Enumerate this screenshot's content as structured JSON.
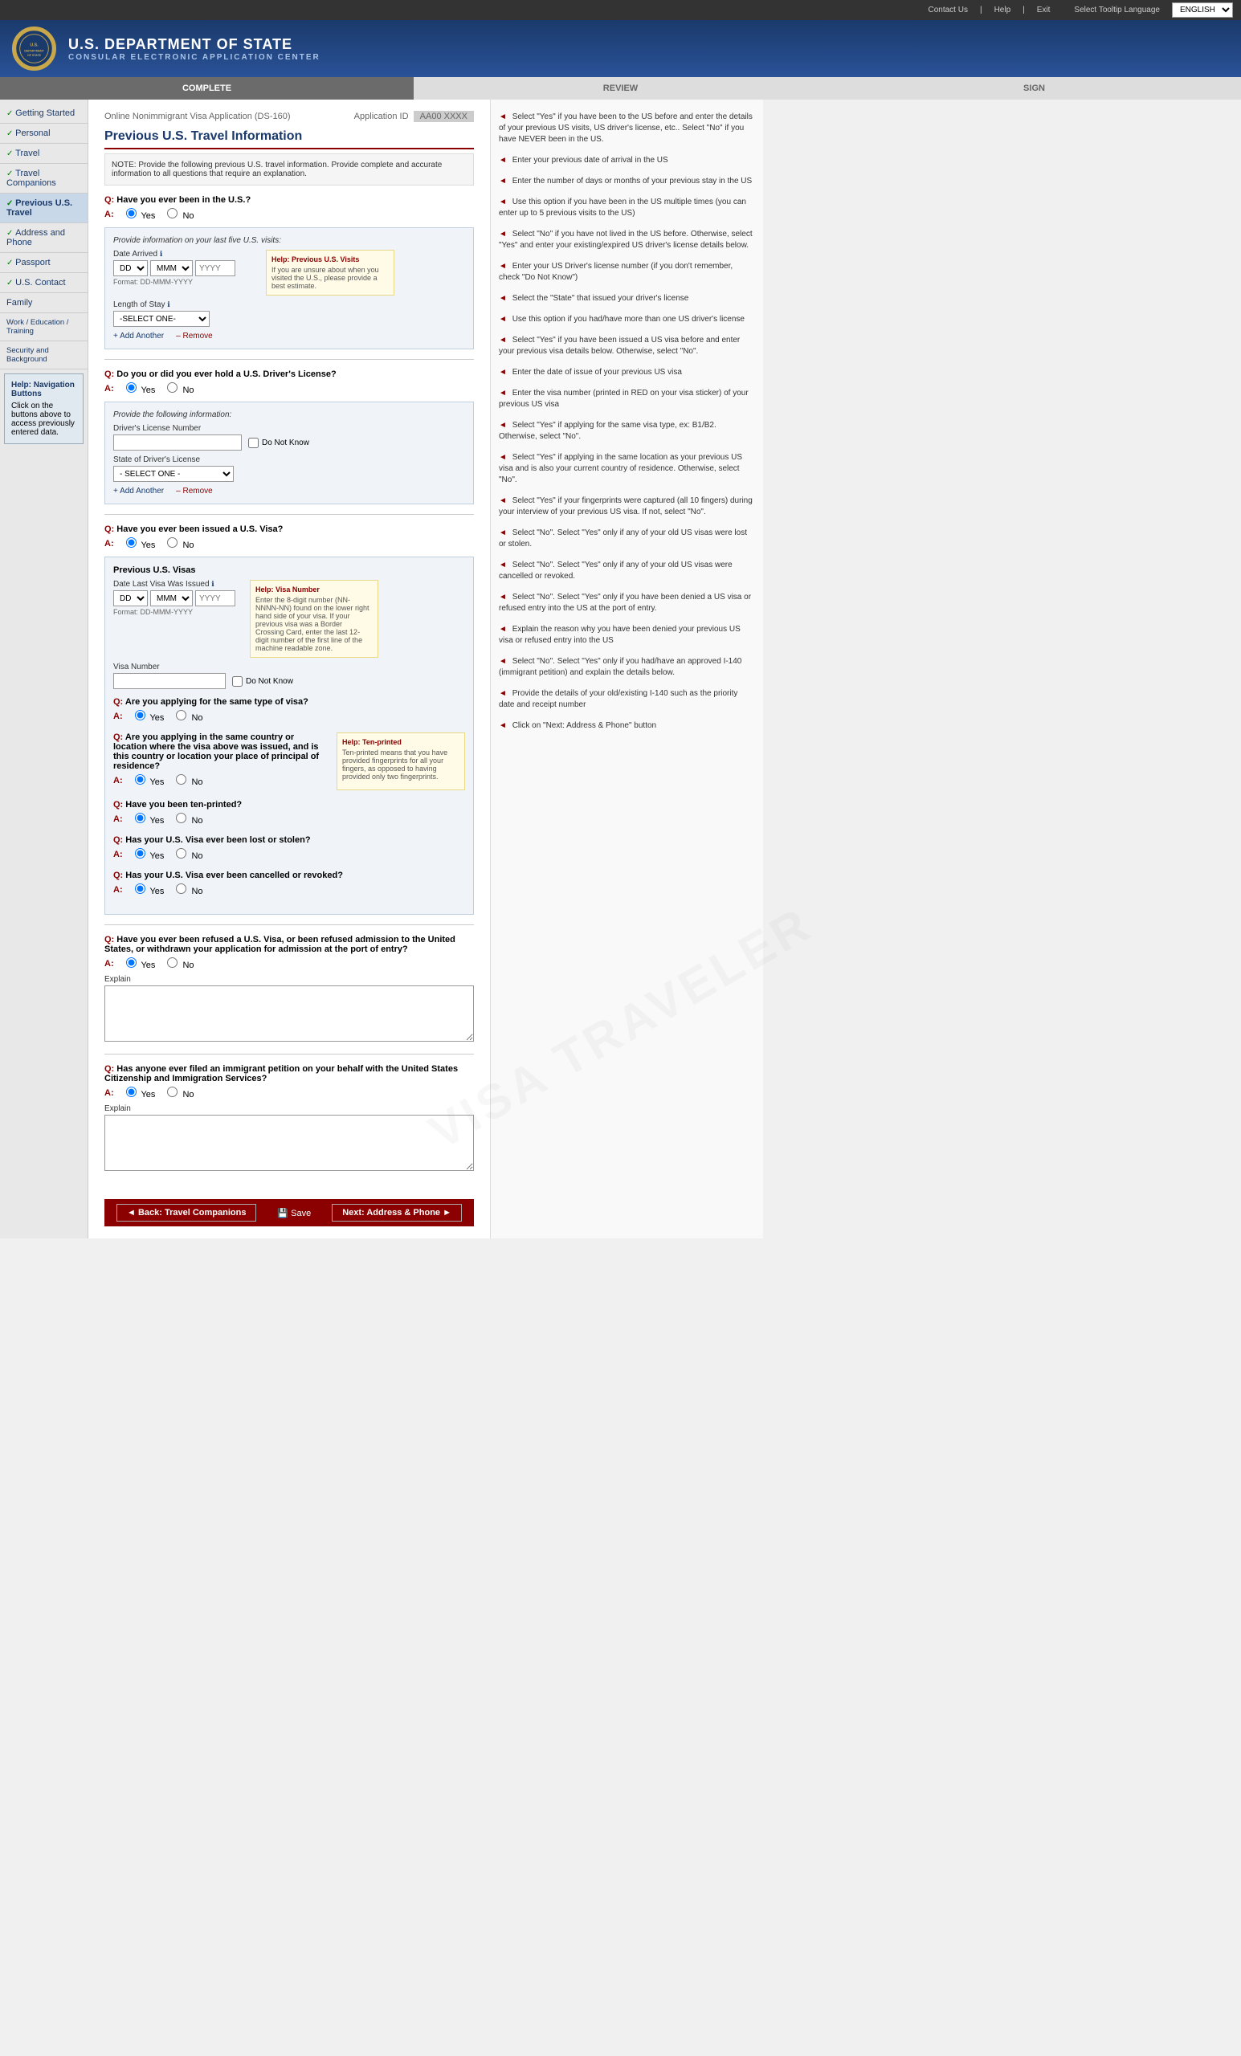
{
  "topbar": {
    "contact_us": "Contact Us",
    "help": "Help",
    "exit": "Exit",
    "select_language": "Select Tooltip Language",
    "language_value": "ENGLISH"
  },
  "header": {
    "seal_text": "U.S.",
    "title": "U.S. Department of State",
    "subtitle": "CONSULAR ELECTRONIC APPLICATION CENTER"
  },
  "progress": {
    "steps": [
      {
        "label": "COMPLETE",
        "state": "done"
      },
      {
        "label": "REVIEW",
        "state": "upcoming"
      },
      {
        "label": "SIGN",
        "state": "upcoming"
      }
    ]
  },
  "app_info": {
    "form_name": "Online Nonimmigrant Visa Application (DS-160)",
    "app_id_label": "Application ID",
    "app_id_value": "AA00 XXXX"
  },
  "sidebar": {
    "items": [
      {
        "label": "Getting Started",
        "check": true,
        "active": false
      },
      {
        "label": "Personal",
        "check": true,
        "active": false
      },
      {
        "label": "Travel",
        "check": true,
        "active": false
      },
      {
        "label": "Travel Companions",
        "check": true,
        "active": false
      },
      {
        "label": "Previous U.S. Travel",
        "check": true,
        "active": true
      },
      {
        "label": "Address and Phone",
        "check": true,
        "active": false
      },
      {
        "label": "Passport",
        "check": true,
        "active": false
      },
      {
        "label": "U.S. Contact",
        "check": true,
        "active": false
      },
      {
        "label": "Family",
        "check": false,
        "active": false
      },
      {
        "label": "Work / Education / Training",
        "check": false,
        "active": false
      },
      {
        "label": "Security and Background",
        "check": false,
        "active": false
      }
    ],
    "help_title": "Help: Navigation Buttons",
    "help_text": "Click on the buttons above to access previously entered data."
  },
  "page": {
    "title": "Previous U.S. Travel Information",
    "note": "NOTE: Provide the following previous U.S. travel information. Provide complete and accurate information to all questions that require an explanation."
  },
  "questions": {
    "q1": {
      "text": "Have you ever been in the U.S.?",
      "answer": "Yes",
      "options": [
        "Yes",
        "No"
      ],
      "subsection_title": "Provide information on your last five U.S. visits:",
      "date_label": "Date Arrived",
      "date_info": "ℹ",
      "format": "Format: DD-MMM-YYYY",
      "length_label": "Length of Stay",
      "length_info": "ℹ",
      "select_default": "-SELECT ONE-",
      "add_another": "Add Another",
      "remove": "Remove",
      "help_title": "Help: Previous U.S. Visits",
      "help_text": "If you are unsure about when you visited the U.S., please provide a best estimate."
    },
    "q2": {
      "text": "Do you or did you ever hold a U.S. Driver's License?",
      "answer": "Yes",
      "options": [
        "Yes",
        "No"
      ],
      "subsection_title": "Provide the following information:",
      "license_label": "Driver's License Number",
      "do_not_know": "Do Not Know",
      "state_label": "State of Driver's License",
      "state_select": "- SELECT ONE -",
      "add_another": "Add Another",
      "remove": "Remove"
    },
    "q3": {
      "text": "Have you ever been issued a U.S. Visa?",
      "answer": "Yes",
      "options": [
        "Yes",
        "No"
      ],
      "subsection_title": "Previous U.S. Visas",
      "date_label": "Date Last Visa Was Issued",
      "date_info": "ℹ",
      "format": "Format: DD-MMM-YYYY",
      "visa_number_label": "Visa Number",
      "do_not_know": "Do Not Know",
      "help_title": "Help: Visa Number",
      "help_text": "Enter the 8-digit number (NN-NNNN-NN) found on the lower right hand side of your visa. If your previous visa was a Border Crossing Card, enter the last 12-digit number of the first line of the machine readable zone."
    },
    "q3a": {
      "text": "Are you applying for the same type of visa?",
      "answer": "Yes",
      "options": [
        "Yes",
        "No"
      ]
    },
    "q3b": {
      "text": "Are you applying in the same country or location where the visa above was issued, and is this country or location your place of principal of residence?",
      "answer": "Yes",
      "options": [
        "Yes",
        "No"
      ],
      "help_title": "Help: Ten-printed",
      "help_text": "Ten-printed means that you have provided fingerprints for all your fingers, as opposed to having provided only two fingerprints."
    },
    "q3c": {
      "text": "Have you been ten-printed?",
      "answer": "Yes",
      "options": [
        "Yes",
        "No"
      ]
    },
    "q3d": {
      "text": "Has your U.S. Visa ever been lost or stolen?",
      "answer": "Yes",
      "options": [
        "Yes",
        "No"
      ]
    },
    "q3e": {
      "text": "Has your U.S. Visa ever been cancelled or revoked?",
      "answer": "Yes",
      "options": [
        "Yes",
        "No"
      ]
    },
    "q4": {
      "text": "Have you ever been refused a U.S. Visa, or been refused admission to the United States, or withdrawn your application for admission at the port of entry?",
      "answer": "Yes",
      "options": [
        "Yes",
        "No"
      ],
      "explain_label": "Explain"
    },
    "q5": {
      "text": "Has anyone ever filed an immigrant petition on your behalf with the United States Citizenship and Immigration Services?",
      "answer": "Yes",
      "options": [
        "Yes",
        "No"
      ],
      "explain_label": "Explain"
    }
  },
  "footer": {
    "back_label": "◄ Back: Travel Companions",
    "save_label": "💾 Save",
    "next_label": "Next: Address & Phone ►"
  },
  "annotations": [
    "Select \"Yes\" if you have been to the US before and enter the details of your previous US visits, US driver's license, etc.. Select \"No\" if you have NEVER been in the US.",
    "Enter your previous date of arrival in the US",
    "Enter the number of days or months of your previous stay in the US",
    "Use this option if you have been in the US multiple times (you can enter up to 5 previous visits to the US)",
    "Select \"No\" if you have not lived in the US before. Otherwise, select \"Yes\" and enter your existing/expired US driver's license details below.",
    "Enter your US Driver's license number (if you don't remember, check \"Do Not Know\")",
    "Select the \"State\" that issued your driver's license",
    "Use this option if you had/have more than one US driver's license",
    "Select \"Yes\" if you have been issued a US visa before and enter your previous visa details below. Otherwise, select \"No\".",
    "Enter the date of issue of your previous US visa",
    "Enter the visa number (printed in RED on your visa sticker) of your previous US visa",
    "Select \"Yes\" if applying for the same visa type, ex: B1/B2. Otherwise, select \"No\".",
    "Select \"Yes\" if applying in the same location as your previous US visa and is also your current country of residence. Otherwise, select \"No\".",
    "Select \"Yes\" if your fingerprints were captured (all 10 fingers) during your interview of your previous US visa. If not, select \"No\".",
    "Select \"No\". Select \"Yes\" only if any of your old US visas were lost or stolen.",
    "Select \"No\". Select \"Yes\" only if any of your old US visas were cancelled or revoked.",
    "Select \"No\". Select \"Yes\" only if you have been denied a US visa or refused entry into the US at the port of entry.",
    "Explain the reason why you have been denied your previous US visa or refused entry into the US",
    "Select \"No\". Select \"Yes\" only if you had/have an approved I-140 (immigrant petition) and explain the details below.",
    "Provide the details of your old/existing I-140 such as the priority date and receipt number",
    "Click on \"Next: Address & Phone\" button"
  ]
}
